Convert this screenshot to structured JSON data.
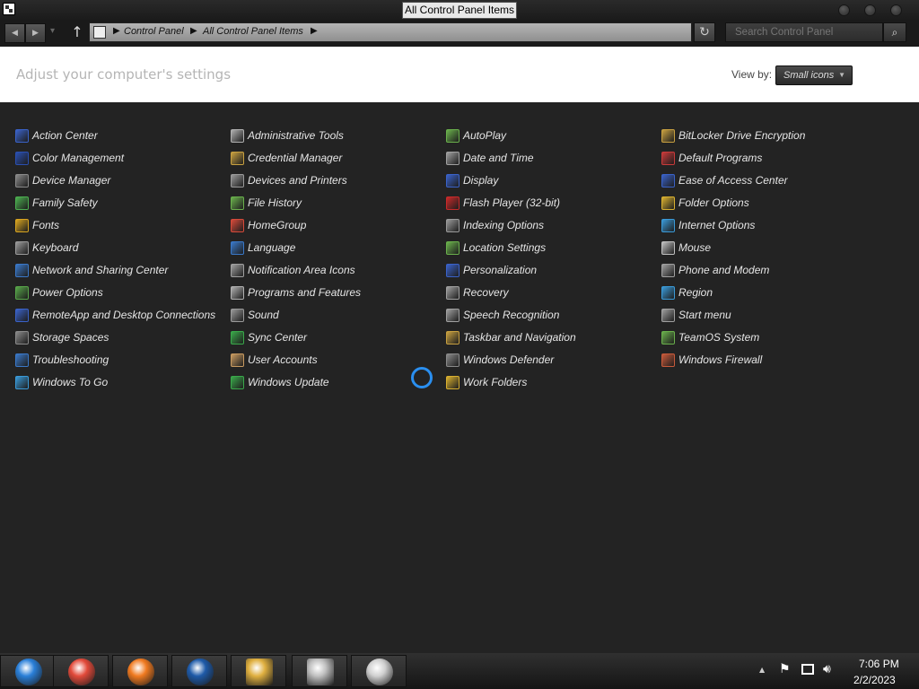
{
  "window": {
    "title": "All Control Panel Items"
  },
  "nav": {
    "back_icon": "back-arrow-icon",
    "forward_icon": "forward-arrow-icon",
    "up_icon": "up-arrow-icon",
    "breadcrumb": [
      "Control Panel",
      "All Control Panel Items"
    ],
    "refresh_icon": "refresh-icon",
    "search_placeholder": "Search Control Panel",
    "search_icon": "search-icon"
  },
  "header": {
    "heading": "Adjust your computer's settings",
    "viewby_label": "View by:",
    "viewby_value": "Small icons"
  },
  "items": [
    {
      "label": "Action Center",
      "icon": "flag-icon",
      "color": "#3a62c8"
    },
    {
      "label": "Color Management",
      "icon": "monitor-icon",
      "color": "#2a4fb0"
    },
    {
      "label": "Device Manager",
      "icon": "device-icon",
      "color": "#8a8a8a"
    },
    {
      "label": "Family Safety",
      "icon": "family-icon",
      "color": "#4caf50"
    },
    {
      "label": "Fonts",
      "icon": "folder-font-icon",
      "color": "#d9a520"
    },
    {
      "label": "Keyboard",
      "icon": "keyboard-icon",
      "color": "#9a9a9a"
    },
    {
      "label": "Network and Sharing Center",
      "icon": "network-icon",
      "color": "#3a78c8"
    },
    {
      "label": "Power Options",
      "icon": "power-icon",
      "color": "#58a64a"
    },
    {
      "label": "RemoteApp and Desktop Connections",
      "icon": "remote-icon",
      "color": "#3a62c8"
    },
    {
      "label": "Storage Spaces",
      "icon": "storage-icon",
      "color": "#8a8a8a"
    },
    {
      "label": "Troubleshooting",
      "icon": "troubleshoot-icon",
      "color": "#3a78c8"
    },
    {
      "label": "Windows To Go",
      "icon": "windows-to-go-icon",
      "color": "#3a9ad8"
    },
    {
      "label": "Administrative Tools",
      "icon": "tools-icon",
      "color": "#b0b0b0"
    },
    {
      "label": "Credential Manager",
      "icon": "credential-icon",
      "color": "#c8a040"
    },
    {
      "label": "Devices and Printers",
      "icon": "printer-icon",
      "color": "#9a9a9a"
    },
    {
      "label": "File History",
      "icon": "file-history-icon",
      "color": "#6ab04c"
    },
    {
      "label": "HomeGroup",
      "icon": "homegroup-icon",
      "color": "#d64a3a"
    },
    {
      "label": "Language",
      "icon": "language-icon",
      "color": "#3a78c8"
    },
    {
      "label": "Notification Area Icons",
      "icon": "notification-icon",
      "color": "#a0a0a0"
    },
    {
      "label": "Programs and Features",
      "icon": "programs-icon",
      "color": "#b0b0b0"
    },
    {
      "label": "Sound",
      "icon": "speaker-icon",
      "color": "#9a9a9a"
    },
    {
      "label": "Sync Center",
      "icon": "sync-icon",
      "color": "#3aa84a"
    },
    {
      "label": "User Accounts",
      "icon": "users-icon",
      "color": "#c89a60"
    },
    {
      "label": "Windows Update",
      "icon": "update-icon",
      "color": "#3aa84a"
    },
    {
      "label": "AutoPlay",
      "icon": "autoplay-icon",
      "color": "#6ab04c"
    },
    {
      "label": "Date and Time",
      "icon": "clock-icon",
      "color": "#a0a0a0"
    },
    {
      "label": "Display",
      "icon": "display-icon",
      "color": "#3a62c8"
    },
    {
      "label": "Flash Player (32-bit)",
      "icon": "flash-icon",
      "color": "#c82a2a"
    },
    {
      "label": "Indexing Options",
      "icon": "indexing-icon",
      "color": "#9a9a9a"
    },
    {
      "label": "Location Settings",
      "icon": "location-icon",
      "color": "#6ab04c"
    },
    {
      "label": "Personalization",
      "icon": "personalization-icon",
      "color": "#3a62c8"
    },
    {
      "label": "Recovery",
      "icon": "recovery-icon",
      "color": "#a0a0a0"
    },
    {
      "label": "Speech Recognition",
      "icon": "microphone-icon",
      "color": "#a0a0a0"
    },
    {
      "label": "Taskbar and Navigation",
      "icon": "taskbar-icon",
      "color": "#c8a040"
    },
    {
      "label": "Windows Defender",
      "icon": "defender-icon",
      "color": "#8a8a8a"
    },
    {
      "label": "Work Folders",
      "icon": "folder-icon",
      "color": "#d9b030"
    },
    {
      "label": "BitLocker Drive Encryption",
      "icon": "bitlocker-icon",
      "color": "#c8a040"
    },
    {
      "label": "Default Programs",
      "icon": "default-programs-icon",
      "color": "#c83a3a"
    },
    {
      "label": "Ease of Access Center",
      "icon": "ease-of-access-icon",
      "color": "#3a62c8"
    },
    {
      "label": "Folder Options",
      "icon": "folder-options-icon",
      "color": "#d9b030"
    },
    {
      "label": "Internet Options",
      "icon": "internet-icon",
      "color": "#3a9ad8"
    },
    {
      "label": "Mouse",
      "icon": "mouse-icon",
      "color": "#c0c0c0"
    },
    {
      "label": "Phone and Modem",
      "icon": "phone-icon",
      "color": "#a0a0a0"
    },
    {
      "label": "Region",
      "icon": "globe-icon",
      "color": "#3a9ad8"
    },
    {
      "label": "Start menu",
      "icon": "start-menu-icon",
      "color": "#a0a0a0"
    },
    {
      "label": "TeamOS System",
      "icon": "teamos-icon",
      "color": "#6ab04c"
    },
    {
      "label": "Windows Firewall",
      "icon": "firewall-icon",
      "color": "#c85a3a"
    }
  ],
  "taskbar": {
    "apps": [
      {
        "name": "start-button",
        "icon": "windows-orb-icon",
        "color": "#2a7fd8"
      },
      {
        "name": "chrome",
        "icon": "chrome-icon",
        "color": "#e24a3a"
      },
      {
        "name": "firefox",
        "icon": "firefox-icon",
        "color": "#f07a20"
      },
      {
        "name": "app-circle",
        "icon": "circle-logo-icon",
        "color": "#1e5aa8"
      },
      {
        "name": "file-explorer",
        "icon": "folder-icon",
        "color": "#e0b040"
      },
      {
        "name": "control-panel",
        "icon": "control-panel-icon",
        "color": "#c0c0c0"
      },
      {
        "name": "mouse-app",
        "icon": "mouse-icon",
        "color": "#d0d0d0"
      }
    ],
    "time": "7:06 PM",
    "date": "2/2/2023"
  }
}
